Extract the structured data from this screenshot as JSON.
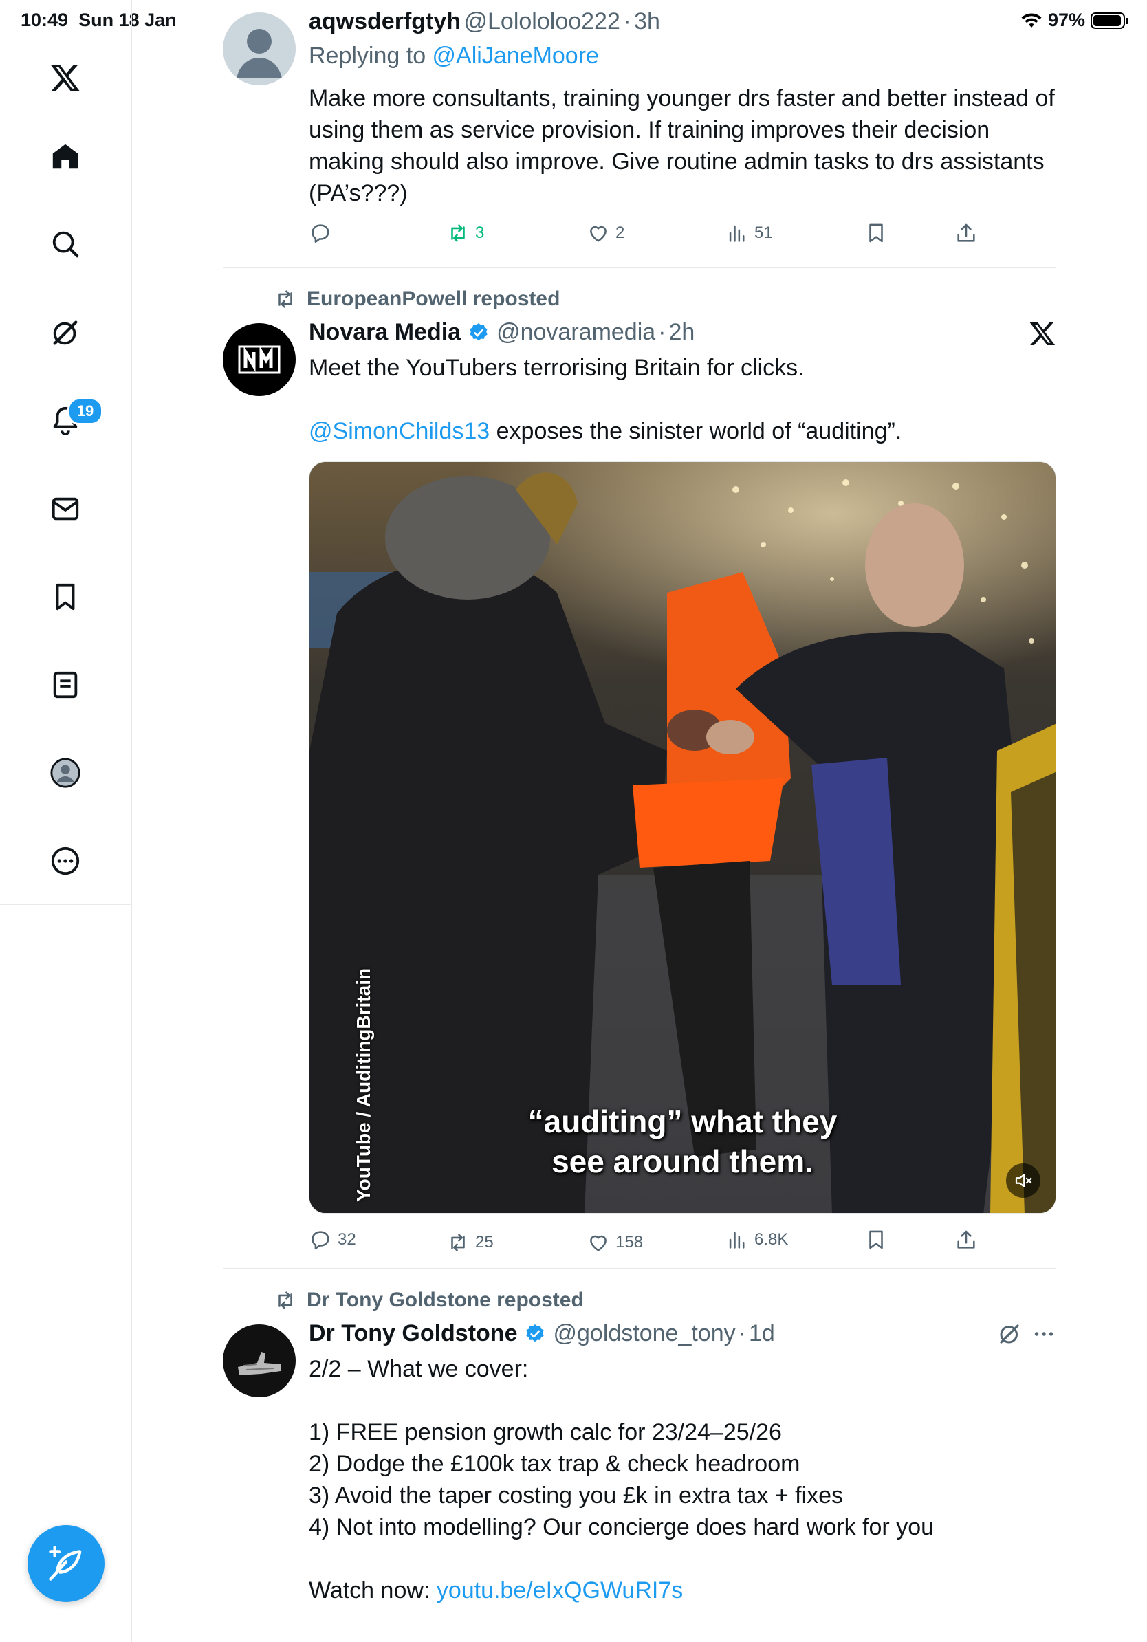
{
  "status_bar": {
    "time": "10:49",
    "date": "Sun 18 Jan",
    "battery": "97%"
  },
  "sidebar": {
    "items": [
      {
        "name": "x-logo-icon"
      },
      {
        "name": "home-icon"
      },
      {
        "name": "search-icon"
      },
      {
        "name": "grok-icon"
      },
      {
        "name": "notifications-icon"
      },
      {
        "name": "messages-icon"
      },
      {
        "name": "bookmarks-icon"
      },
      {
        "name": "lists-icon"
      },
      {
        "name": "profile-icon"
      },
      {
        "name": "more-icon"
      }
    ],
    "notification_count": "19"
  },
  "tweets": [
    {
      "display_name": "aqwsderfgtyh",
      "handle": "@Lolololoo222",
      "time": "3h",
      "replying_prefix": "Replying to ",
      "replying_to": "@AliJaneMoore",
      "text": "Make more consultants, training younger drs faster and better instead of using them as service provision. If training improves their decision making should also improve. Give routine admin tasks to drs assistants (PA’s???)",
      "actions": {
        "replies": "",
        "reposts": "3",
        "likes": "2",
        "views": "51"
      }
    },
    {
      "repost_by": "EuropeanPowell reposted",
      "display_name": "Novara Media",
      "handle": "@novaramedia",
      "time": "2h",
      "text_line1": "Meet the YouTubers terrorising Britain for clicks.",
      "mention": "@SimonChilds13",
      "text_line2_rest": " exposes the sinister world of “auditing”.",
      "media": {
        "caption_line1": "“auditing” what they",
        "caption_line2": "see around them.",
        "credit": "YouTube / AuditingBritain"
      },
      "actions": {
        "replies": "32",
        "reposts": "25",
        "likes": "158",
        "views": "6.8K"
      }
    },
    {
      "repost_by": "Dr Tony Goldstone reposted",
      "display_name": "Dr Tony Goldstone",
      "handle": "@goldstone_tony",
      "time": "1d",
      "line0": "2/2 – What we cover:",
      "line1": "1) FREE pension growth calc for 23/24–25/26",
      "line2": "2) Dodge the £100k tax trap & check headroom",
      "line3": "3) Avoid the taper costing you £k in extra tax + fixes",
      "line4": "4) Not into modelling? Our concierge does hard work for you",
      "watch_prefix": "Watch now: ",
      "watch_link": "youtu.be/eIxQGWuRI7s"
    }
  ],
  "colors": {
    "accent": "#1d9bf0",
    "repost_green": "#00ba7c",
    "muted": "#536471"
  }
}
